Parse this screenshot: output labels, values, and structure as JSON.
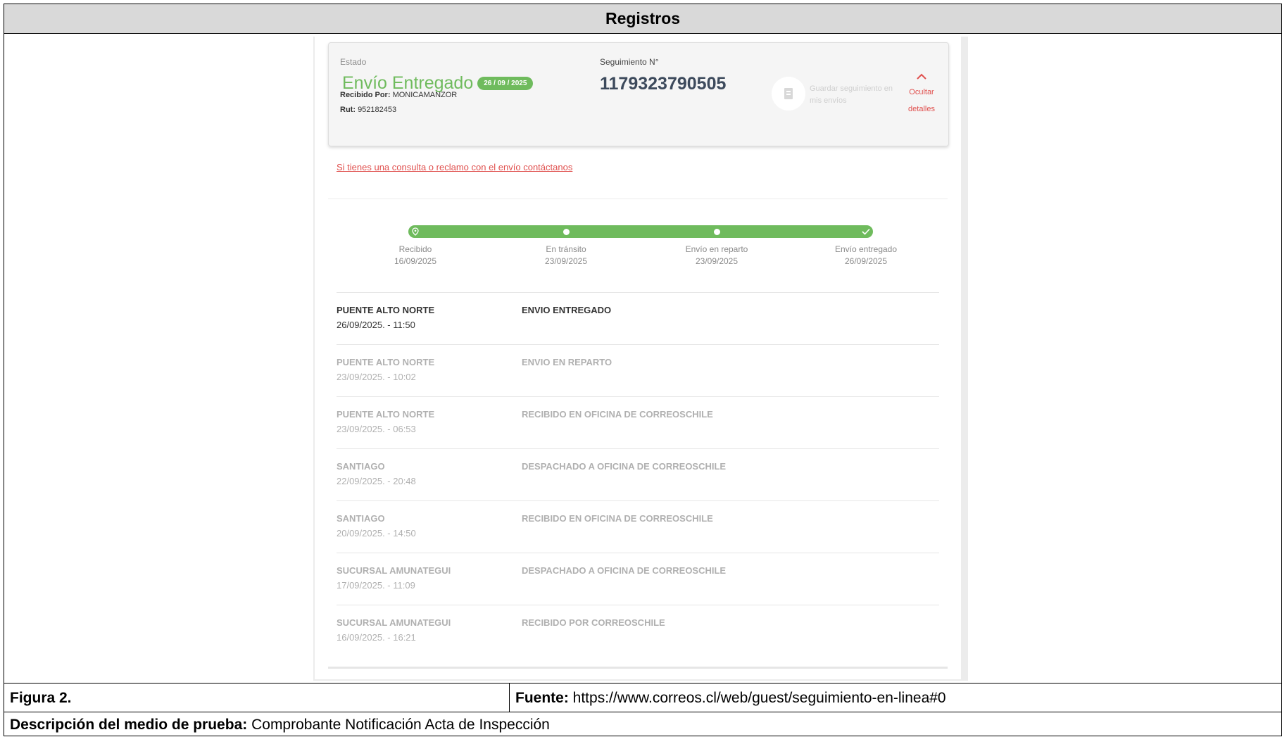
{
  "header": {
    "title": "Registros"
  },
  "footer": {
    "figura_label": "Figura 2.",
    "fuente_label": "Fuente:",
    "fuente_value": "https://www.correos.cl/web/guest/seguimiento-en-linea#0",
    "descripcion_label": "Descripción del medio de prueba:",
    "descripcion_value": "Comprobante Notificación Acta de Inspección"
  },
  "tracking": {
    "estado_label": "Estado",
    "estado_value": "Envío Entregado",
    "estado_date": "26 / 09 / 2025",
    "recibido_label": "Recibido Por:",
    "recibido_value": "MONICAMANZOR",
    "rut_label": "Rut:",
    "rut_value": "952182453",
    "seguimiento_label": "Seguimiento N°",
    "seguimiento_value": "1179323790505",
    "save_text": "Guardar seguimiento en mis envíos",
    "hide_label_1": "Ocultar",
    "hide_label_2": "detalles",
    "contact_link": "Si tienes una consulta o reclamo con el envío contáctanos",
    "colors": {
      "accent_green": "#6fbb5d",
      "accent_red": "#e0504e"
    },
    "progress_fraction": 1.0,
    "steps": [
      {
        "label": "Recibido",
        "date": "16/09/2025",
        "icon": "location-pin-icon"
      },
      {
        "label": "En tránsito",
        "date": "23/09/2025",
        "icon": "dot-icon"
      },
      {
        "label": "Envío en reparto",
        "date": "23/09/2025",
        "icon": "dot-icon"
      },
      {
        "label": "Envío entregado",
        "date": "26/09/2025",
        "icon": "check-icon"
      }
    ],
    "events": [
      {
        "place": "PUENTE ALTO NORTE",
        "datetime": "26/09/2025. - 11:50",
        "event": "ENVIO ENTREGADO"
      },
      {
        "place": "PUENTE ALTO NORTE",
        "datetime": "23/09/2025. - 10:02",
        "event": "ENVIO EN REPARTO"
      },
      {
        "place": "PUENTE ALTO NORTE",
        "datetime": "23/09/2025. - 06:53",
        "event": "RECIBIDO EN OFICINA DE CORREOSCHILE"
      },
      {
        "place": "SANTIAGO",
        "datetime": "22/09/2025. - 20:48",
        "event": "DESPACHADO A OFICINA DE CORREOSCHILE"
      },
      {
        "place": "SANTIAGO",
        "datetime": "20/09/2025. - 14:50",
        "event": "RECIBIDO EN OFICINA DE CORREOSCHILE"
      },
      {
        "place": "SUCURSAL AMUNATEGUI",
        "datetime": "17/09/2025. - 11:09",
        "event": "DESPACHADO A OFICINA DE CORREOSCHILE"
      },
      {
        "place": "SUCURSAL AMUNATEGUI",
        "datetime": "16/09/2025. - 16:21",
        "event": "RECIBIDO POR CORREOSCHILE"
      }
    ]
  }
}
